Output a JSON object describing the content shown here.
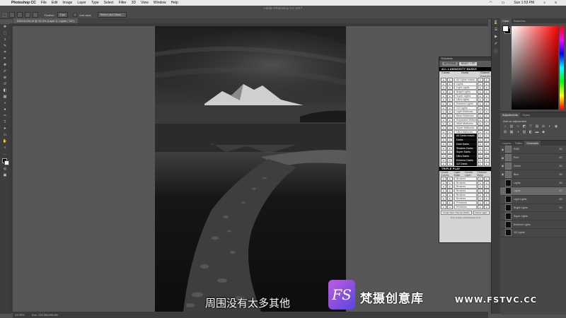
{
  "menubar": {
    "app": "Photoshop CC",
    "items": [
      "File",
      "Edit",
      "Image",
      "Layer",
      "Type",
      "Select",
      "Filter",
      "3D",
      "View",
      "Window",
      "Help"
    ],
    "clock": "Sun 1:53 PM"
  },
  "options": {
    "window_title": "Adobe Photoshop CC 2017",
    "feather_label": "Feather:",
    "feather_value": "0 px",
    "antialias_label": "Anti-alias",
    "select_mask_button": "Select and Mask..."
  },
  "document": {
    "tab_title": "DSC01234.tif @ 33.3% (Layer 0, Lights / 16*)",
    "zoom": "33.33%",
    "doc_info": "Doc: 133.0M/496.0M"
  },
  "luminosity_panel": {
    "header": "TKActions",
    "tabs": [
      "ACTIONS",
      "BASIC + FP"
    ],
    "section_all": "ALL LUMINOSITY MASKS",
    "top_options": [
      "Curves",
      "Levels",
      "Channel"
    ],
    "col_label": "Channels",
    "lights": [
      "All Lights masks",
      "Lights",
      "Light Lights",
      "Bright Lights",
      "Super Lights",
      "Ultra Lights",
      "Extreme Lights",
      "1/2 Lights",
      "Light Midtones",
      "Basic Midtones",
      "Expanded Midtones",
      "Wide Midtones",
      "Super Midtones",
      "Ultra Midtones"
    ],
    "darks": [
      "All Darks masks",
      "Darks",
      "Dark Darks",
      "Shadow Darks",
      "Super Darks",
      "Ultra Darks",
      "Extreme Darks",
      "1/2 Darks"
    ],
    "section_triple": "TRIPLE PLAY",
    "triple_cols": [
      "Levels Curves",
      "Layer Mask",
      "Curves Layer",
      "Channel Mask"
    ],
    "triple_rows": [
      "Brushes",
      "Brushes",
      "Brushes",
      "Brushes",
      "Brushes",
      "Brushes",
      "Previews",
      "Previews"
    ],
    "footer_buttons": [
      "Create New Channel (Adds)",
      "Delete Again"
    ],
    "credit": "Tony Kuyper (www.tkuyper.com)"
  },
  "color_panel": {
    "tabs": [
      "Color",
      "Swatches"
    ]
  },
  "adjustments_panel": {
    "tabs": [
      "Adjustments",
      "Styles"
    ],
    "add_label": "Add an adjustment"
  },
  "layers_panel": {
    "tabs": [
      "Layers",
      "Paths",
      "Channels"
    ],
    "channels": [
      {
        "name": "RGB",
        "shortcut": "⌘2"
      },
      {
        "name": "Red",
        "shortcut": "⌘3"
      },
      {
        "name": "Green",
        "shortcut": "⌘4"
      },
      {
        "name": "Blue",
        "shortcut": "⌘5"
      },
      {
        "name": "Lights",
        "shortcut": "⌘6"
      },
      {
        "name": "Lights",
        "shortcut": "⌘7"
      },
      {
        "name": "Light Lights",
        "shortcut": "⌘8"
      },
      {
        "name": "Bright Lights",
        "shortcut": "⌘9"
      },
      {
        "name": "Super Lights",
        "shortcut": ""
      },
      {
        "name": "Extreme Lights",
        "shortcut": ""
      },
      {
        "name": "1/2 Lights",
        "shortcut": ""
      }
    ]
  },
  "subtitle": "周围没有太多其他",
  "watermark": {
    "logo": "FS",
    "name": "梵摄创意库",
    "url": "WWW.FSTVC.CC"
  },
  "colors": {
    "canvas_bg": "#575757",
    "panel_bg": "#4a4a4a",
    "watermark_accent": "#a04ee0"
  }
}
